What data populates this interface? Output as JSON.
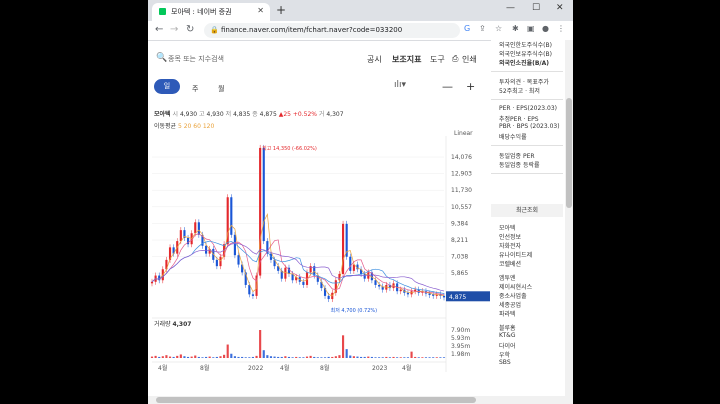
{
  "browser": {
    "tab_title": "모아텍 : 네이버 증권",
    "tab_close": "✕",
    "new_tab": "+",
    "url": "finance.naver.com/item/fchart.naver?code=033200",
    "minimize": "—",
    "maximize": "☐",
    "close": "✕"
  },
  "toolbar": {
    "search_placeholder": "종목 또는 지수검색",
    "items": [
      "공시",
      "보조지표",
      "도구",
      "인쇄"
    ],
    "periods": [
      "일",
      "주",
      "월"
    ]
  },
  "ohlc": {
    "name": "모아텍",
    "open_label": "시",
    "open": "4,930",
    "high_label": "고",
    "high": "4,930",
    "low_label": "저",
    "low": "4,835",
    "close_label": "종",
    "close": "4,875",
    "change": "▲25 +0.52%",
    "prev_label": "거",
    "prev": "4,307"
  },
  "ma": {
    "label": "이동평균",
    "periods": "5 20 60 120"
  },
  "chart_scale": "Linear",
  "colors": {
    "up": "#e4282c",
    "down": "#1a56d6",
    "ma5": "#e9a23b",
    "ma20": "#e35a8a",
    "ma60": "#3c8fe0",
    "ma120": "#8a5fcf",
    "accent": "#2e5ab8"
  },
  "chart_data": {
    "type": "line",
    "title": "모아텍",
    "yaxis_ticks": [
      "14,076",
      "12,903",
      "11,730",
      "10,557",
      "9,384",
      "8,211",
      "7,038",
      "5,865",
      "4,875"
    ],
    "xaxis_ticks": [
      "4월",
      "8월",
      "2022",
      "4월",
      "8월",
      "2023",
      "4월"
    ],
    "ylim": [
      4000,
      14600
    ],
    "current_price": "4,875",
    "annotations": {
      "max": "최고 14,350 (-66.02%)",
      "min": "최저 4,700 (0.72%)"
    },
    "series": [
      {
        "name": "모아텍",
        "values": [
          5800,
          6200,
          5900,
          6600,
          7200,
          8000,
          7600,
          8400,
          9100,
          8600,
          8200,
          8900,
          9600,
          8800,
          8100,
          7600,
          7900,
          7200,
          6800,
          7400,
          8200,
          11200,
          8800,
          7500,
          6900,
          6400,
          5600,
          5000,
          4900,
          6200,
          14350,
          8400,
          7600,
          7200,
          6800,
          6500,
          6000,
          6700,
          6300,
          5900,
          6100,
          5800,
          5600,
          6400,
          6800,
          6200,
          5800,
          5400,
          4900,
          4700,
          5100,
          5900,
          6300,
          9500,
          7400,
          6500,
          6900,
          6600,
          6300,
          6000,
          6400,
          5900,
          5600,
          5500,
          5300,
          5600,
          5400,
          5700,
          5200,
          5300,
          5100,
          5000,
          5200,
          5300,
          5100,
          5200,
          5050,
          5000,
          4950,
          5000,
          4900,
          4875
        ]
      }
    ],
    "volume": {
      "label": "거래량",
      "value": "4,307",
      "ticks": [
        "7.90m",
        "5.93m",
        "3.95m",
        "1.98m"
      ],
      "values": [
        0.4,
        0.6,
        0.3,
        0.5,
        0.8,
        0.4,
        0.3,
        0.6,
        1.0,
        0.5,
        0.3,
        0.4,
        0.7,
        0.3,
        0.2,
        0.3,
        0.4,
        0.2,
        0.3,
        0.5,
        0.9,
        3.8,
        1.2,
        0.5,
        0.3,
        0.3,
        0.2,
        0.2,
        0.3,
        0.6,
        7.9,
        2.2,
        0.8,
        0.5,
        0.4,
        0.3,
        0.3,
        0.5,
        0.3,
        0.2,
        0.3,
        0.2,
        0.2,
        0.4,
        0.6,
        0.3,
        0.2,
        0.2,
        0.2,
        0.3,
        0.3,
        0.5,
        0.8,
        6.4,
        2.5,
        0.7,
        0.5,
        0.4,
        0.3,
        0.3,
        0.4,
        0.3,
        0.2,
        0.2,
        0.2,
        0.3,
        0.2,
        0.3,
        0.2,
        0.2,
        0.2,
        0.2,
        1.8,
        0.3,
        0.2,
        0.2,
        0.2,
        0.2,
        0.2,
        0.2,
        0.2,
        0.2
      ]
    }
  },
  "right_panel": {
    "items1": [
      "외국인한도주식수(B)",
      "외국인보유주식수(B)",
      "외국인소진율(B/A)"
    ],
    "items2": [
      "투자의견 · 목표주가",
      "52주최고 · 최저"
    ],
    "items3": [
      "PER · EPS(2023.03)",
      "추정PER · EPS",
      "PBR · BPS (2023.03)",
      "배당수익률"
    ],
    "items4": [
      "동일업종 PER",
      "동일업종 등락률"
    ],
    "recent_title": "최근조회",
    "recent": [
      "모아텍",
      "인선정보",
      "자화전자",
      "유나이티드제",
      "코렐베션"
    ],
    "recent2": [
      "엠투엔",
      "제이씨현시스",
      "중소사업출",
      "세종공업",
      "파라텍"
    ],
    "recent3": [
      "블루홈",
      "KT&G",
      "다이어",
      "우학",
      "SBS"
    ]
  }
}
